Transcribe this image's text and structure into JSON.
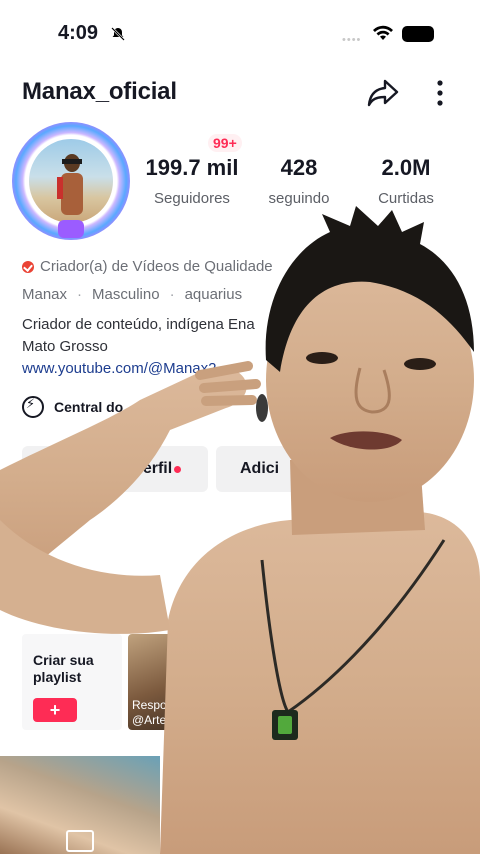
{
  "status_bar": {
    "time": "4:09",
    "dots": "••••"
  },
  "header": {
    "username": "Manax_oficial"
  },
  "notification_badge": "99+",
  "stats": [
    {
      "value": "199.7 mil",
      "label": "Seguidores"
    },
    {
      "value": "428",
      "label": "seguindo"
    },
    {
      "value": "2.0M",
      "label": "Curtidas"
    }
  ],
  "bio": {
    "category": "Criador(a) de Vídeos de Qualidade",
    "tags": [
      "Manax",
      "Masculino",
      "aquarius"
    ],
    "separator": "·",
    "line1": "Criador de conteúdo, indígena Ena",
    "line2": "Mato Grosso",
    "link": "www.youtube.com/@Manax2",
    "creator_center": "Central do"
  },
  "buttons": {
    "edit_profile": "erfil",
    "add": "Adici"
  },
  "playlist": {
    "title": "Criar sua playlist",
    "add": "+"
  },
  "reply_card": {
    "line1": "Respo",
    "line2": "@Arte"
  },
  "colors": {
    "accent": "#fe2c55",
    "link": "#1d3d8f",
    "text": "#161823",
    "muted": "#6c6f76"
  }
}
